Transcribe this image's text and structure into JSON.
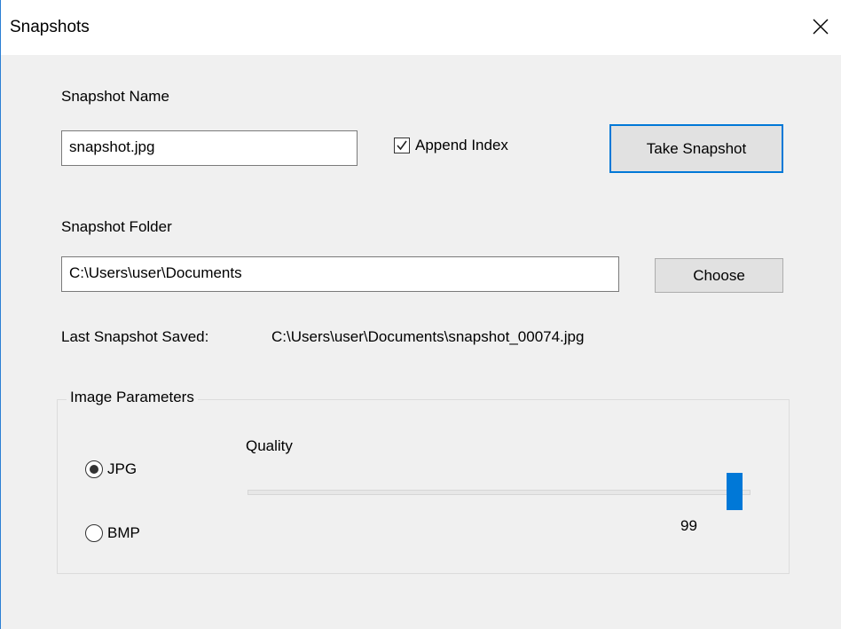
{
  "window": {
    "title": "Snapshots"
  },
  "snapshot_name": {
    "label": "Snapshot Name",
    "value": "snapshot.jpg",
    "append_index_label": "Append Index",
    "append_index_checked": true
  },
  "take_snapshot_button": "Take Snapshot",
  "snapshot_folder": {
    "label": "Snapshot Folder",
    "value": "C:\\Users\\user\\Documents",
    "choose_button": "Choose"
  },
  "last_saved": {
    "label": "Last Snapshot Saved:",
    "value": "C:\\Users\\user\\Documents\\snapshot_00074.jpg"
  },
  "image_parameters": {
    "title": "Image Parameters",
    "formats": [
      {
        "label": "JPG",
        "selected": true
      },
      {
        "label": "BMP",
        "selected": false
      }
    ],
    "quality": {
      "label": "Quality",
      "value": "99",
      "min": 0,
      "max": 100
    }
  },
  "colors": {
    "window_bg": "#f0f0f0",
    "accent": "#0078d7",
    "button_bg": "#e1e1e1"
  }
}
